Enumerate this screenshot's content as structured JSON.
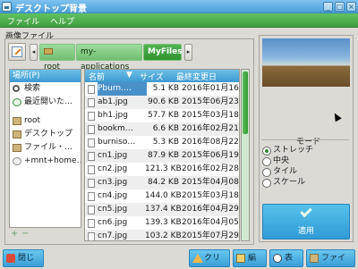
{
  "window": {
    "title": "デスクトップ背景"
  },
  "menubar": {
    "file": "ファイル",
    "help": "ヘルプ"
  },
  "section": {
    "image_file": "画像ファイル"
  },
  "breadcrumb": {
    "items": [
      "root",
      "my-applications",
      "MyFiles"
    ]
  },
  "places": {
    "header": "場所(P)",
    "items": [
      {
        "label": "検索",
        "icon": "search-icon"
      },
      {
        "label": "最近開いた…",
        "icon": "recent-icon"
      },
      {
        "label": "root",
        "icon": "folder-icon"
      },
      {
        "label": "デスクトップ",
        "icon": "folder-icon"
      },
      {
        "label": "ファイル・…",
        "icon": "folder-icon"
      },
      {
        "label": "+mnt+home…",
        "icon": "drive-icon"
      }
    ],
    "add": "+",
    "remove": "−"
  },
  "filelist": {
    "columns": {
      "name": "名前",
      "size": "サイズ",
      "modified": "最終変更日"
    },
    "rows": [
      {
        "name": "Pburn.…",
        "size": "5.1 KB",
        "date": "2016年01月16日"
      },
      {
        "name": "ab1.jpg",
        "size": "90.6 KB",
        "date": "2015年06月23日"
      },
      {
        "name": "bh1.jpg",
        "size": "57.7 KB",
        "date": "2015年03月18日"
      },
      {
        "name": "bookm…",
        "size": "6.6 KB",
        "date": "2016年02月21日"
      },
      {
        "name": "burniso…",
        "size": "5.3 KB",
        "date": "2016年08月22日"
      },
      {
        "name": "cn1.jpg",
        "size": "87.9 KB",
        "date": "2015年06月19日"
      },
      {
        "name": "cn2.jpg",
        "size": "121.3 KB",
        "date": "2016年02月28日"
      },
      {
        "name": "cn3.jpg",
        "size": "84.2 KB",
        "date": "2015年04月08日"
      },
      {
        "name": "cn4.jpg",
        "size": "144.0 KB",
        "date": "2015年03月18日"
      },
      {
        "name": "cn5.jpg",
        "size": "137.4 KB",
        "date": "2016年04月29日"
      },
      {
        "name": "cn6.jpg",
        "size": "139.3 KB",
        "date": "2016年04月05日"
      },
      {
        "name": "cn7.jpg",
        "size": "103.2 KB",
        "date": "2015年07月29日"
      }
    ]
  },
  "mode": {
    "title": "モード",
    "options": [
      "ストレッチ",
      "中央",
      "タイル",
      "スケール"
    ],
    "selected": "ストレッチ"
  },
  "apply_label": "適用",
  "bottom": {
    "close": "閉じる",
    "clear": "クリア",
    "edit": "編集",
    "view": "表示",
    "filer": "ファイラ"
  }
}
